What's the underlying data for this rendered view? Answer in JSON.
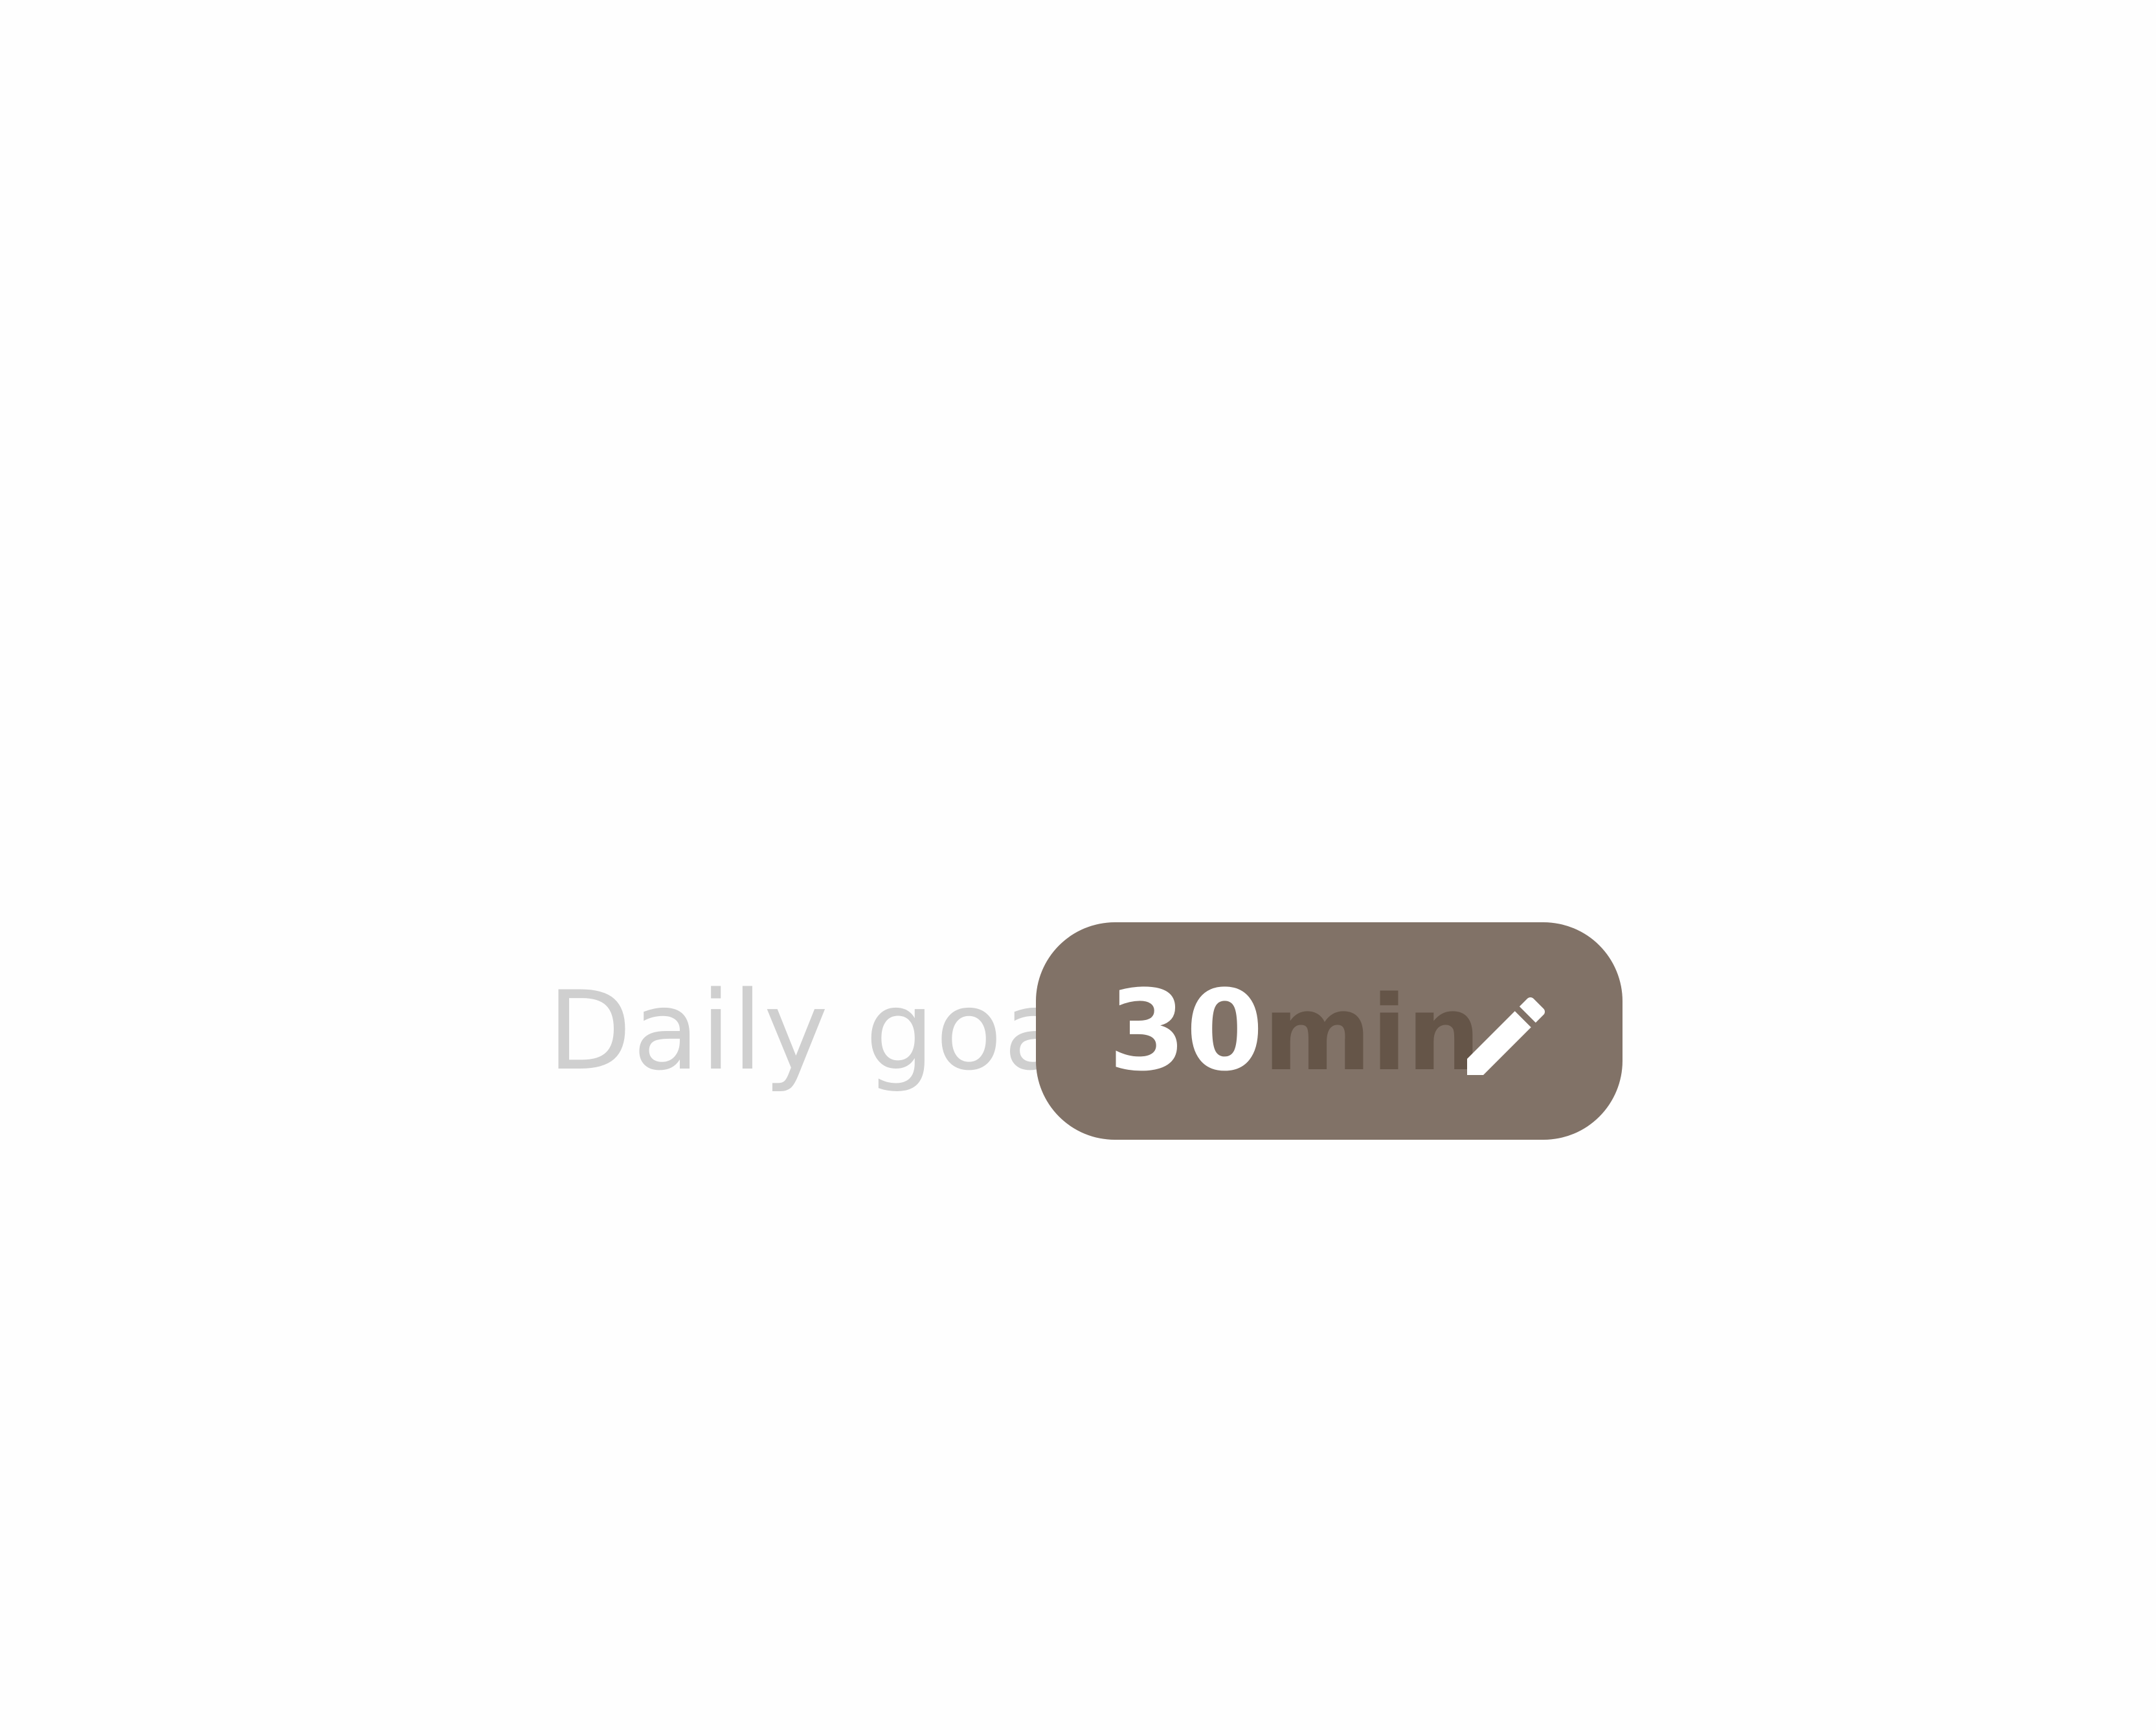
{
  "daily_goal": {
    "label": "Daily goal",
    "value": "30",
    "unit": "min",
    "edit_icon": "pencil-icon"
  },
  "colors": {
    "background": "#fefefe",
    "label": "#cfcfcf",
    "pill": "#817267",
    "value": "#ffffff",
    "unit": "#655548"
  }
}
